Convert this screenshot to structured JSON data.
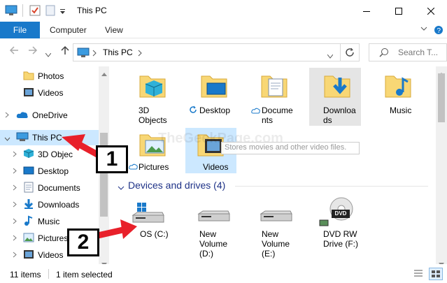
{
  "titlebar": {
    "title": "This PC"
  },
  "ribbon": {
    "tabs": [
      "File",
      "Computer",
      "View"
    ]
  },
  "address": {
    "path": "This PC",
    "search_placeholder": "Search T..."
  },
  "navpane": {
    "items": [
      {
        "label": "Photos",
        "icon": "folder-icon"
      },
      {
        "label": "Videos",
        "icon": "videos-folder-icon"
      },
      {
        "label": "OneDrive",
        "icon": "onedrive-cloud-icon"
      },
      {
        "label": "This PC",
        "icon": "computer-icon"
      },
      {
        "label": "3D Objec",
        "icon": "3d-objects-icon"
      },
      {
        "label": "Desktop",
        "icon": "desktop-icon"
      },
      {
        "label": "Documents",
        "icon": "documents-icon"
      },
      {
        "label": "Downloads",
        "icon": "downloads-icon"
      },
      {
        "label": "Music",
        "icon": "music-icon"
      },
      {
        "label": "Pictures",
        "icon": "pictures-icon"
      },
      {
        "label": "Videos",
        "icon": "videos-folder-icon"
      }
    ]
  },
  "folders": {
    "items": [
      {
        "label_1": "3D",
        "label_2": "Objects"
      },
      {
        "label_1": "Desktop"
      },
      {
        "label_1": "Docume",
        "label_2": "nts"
      },
      {
        "label_1": "Downloa",
        "label_2": "ds"
      },
      {
        "label_1": "Music"
      },
      {
        "label_1": "Pictures"
      },
      {
        "label_1": "Videos"
      }
    ],
    "tooltip": "Stores movies and other video files."
  },
  "devices": {
    "header": "Devices and drives (4)",
    "items": [
      {
        "label_1": "OS (C:)"
      },
      {
        "label_1": "New",
        "label_2": "Volume",
        "label_3": "(D:)"
      },
      {
        "label_1": "New",
        "label_2": "Volume",
        "label_3": "(E:)"
      },
      {
        "label_1": "DVD RW",
        "label_2": "Drive (F:)"
      }
    ],
    "dvd_badge": "DVD"
  },
  "watermark": "TheGeekPage.com",
  "status": {
    "count": "11 items",
    "selected": "1 item selected"
  },
  "callouts": {
    "one": "1",
    "two": "2"
  },
  "colors": {
    "accent": "#1979ca",
    "selection": "#cce8ff",
    "arrow_red": "#e8202a",
    "folder_yellow": "#f8d775"
  }
}
